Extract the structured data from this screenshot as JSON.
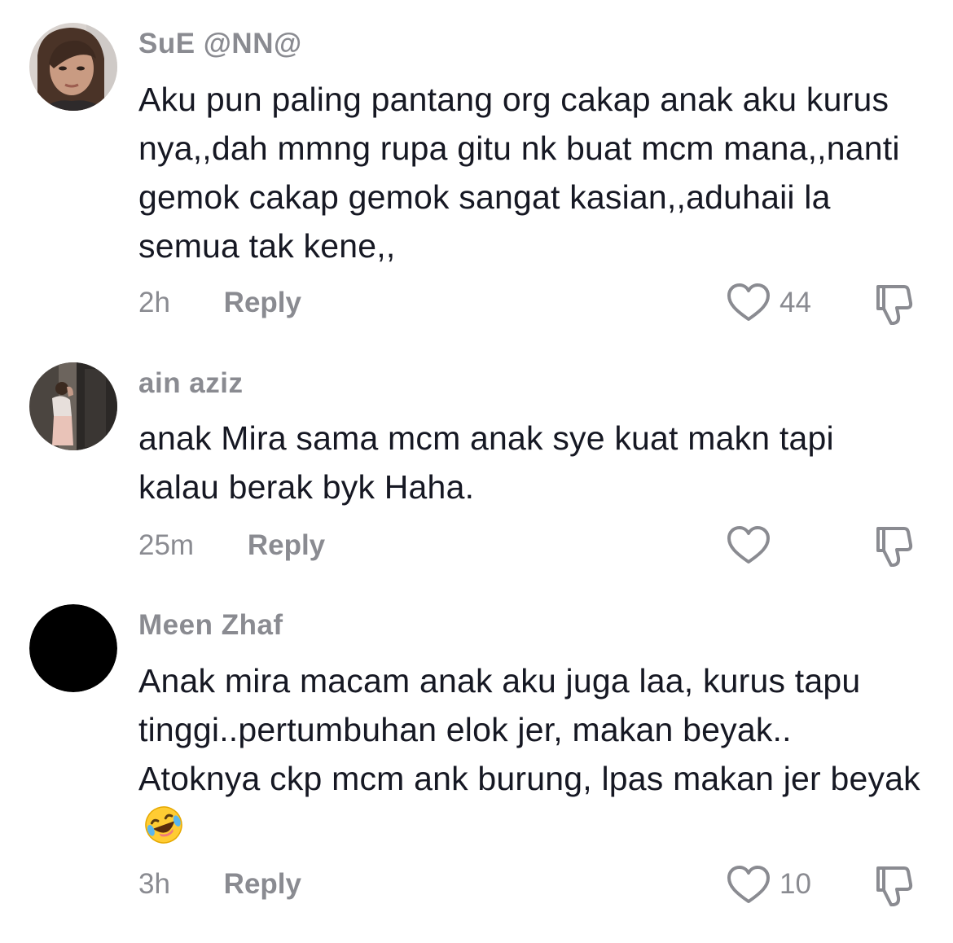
{
  "comments": [
    {
      "username": "SuE @NN@",
      "text": "Aku pun paling pantang org cakap anak aku kurus nya,,dah mmng rupa gitu nk buat mcm mana,,nanti gemok cakap gemok sangat kasian,,aduhaii la semua tak kene,,",
      "time": "2h",
      "reply_label": "Reply",
      "like_count": "44"
    },
    {
      "username": "ain aziz",
      "text": "anak Mira sama mcm anak sye kuat makn tapi kalau berak byk Haha.",
      "time": "25m",
      "reply_label": "Reply",
      "like_count": ""
    },
    {
      "username": "Meen Zhaf",
      "text": "Anak mira macam anak aku juga laa, kurus tapu tinggi..pertumbuhan elok jer, makan beyak.. Atoknya ckp mcm ank burung, lpas makan jer beyak",
      "emoji": "rolling-on-the-floor-laughing-emoji",
      "time": "3h",
      "reply_label": "Reply",
      "like_count": "10"
    }
  ],
  "colors": {
    "text": "#161823",
    "muted": "#8a8b91",
    "icon_stroke": "#8a8b91"
  }
}
